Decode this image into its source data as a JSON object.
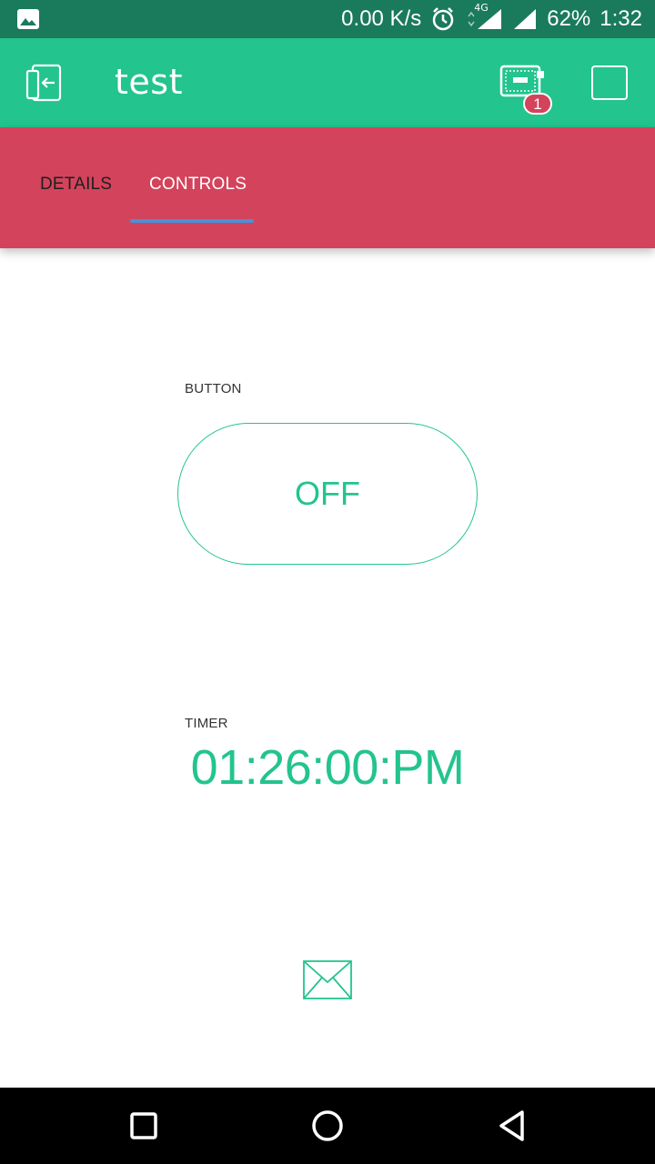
{
  "status_bar": {
    "net_speed": "0.00 K/s",
    "network_type": "4G",
    "battery": "62%",
    "time": "1:32",
    "icons": [
      "gallery-icon",
      "alarm-icon",
      "signal-icon",
      "signal-icon"
    ]
  },
  "app_bar": {
    "title": "test",
    "badge_count": "1",
    "icons": [
      "back-icon",
      "device-icon",
      "square-icon"
    ]
  },
  "tabs": [
    {
      "label": "DETAILS",
      "active": false
    },
    {
      "label": "CONTROLS",
      "active": true
    }
  ],
  "widgets": {
    "button": {
      "label": "BUTTON",
      "state": "OFF"
    },
    "timer": {
      "label": "TIMER",
      "value": "01:26:00:PM"
    },
    "email": {
      "icon": "mail-icon"
    }
  },
  "nav_bar": {
    "icons": [
      "recent-apps-icon",
      "home-icon",
      "back-icon"
    ]
  },
  "colors": {
    "status_bar": "#1a7a5c",
    "primary": "#23c48e",
    "accent": "#d3435c",
    "tab_indicator": "#4a90d9"
  }
}
